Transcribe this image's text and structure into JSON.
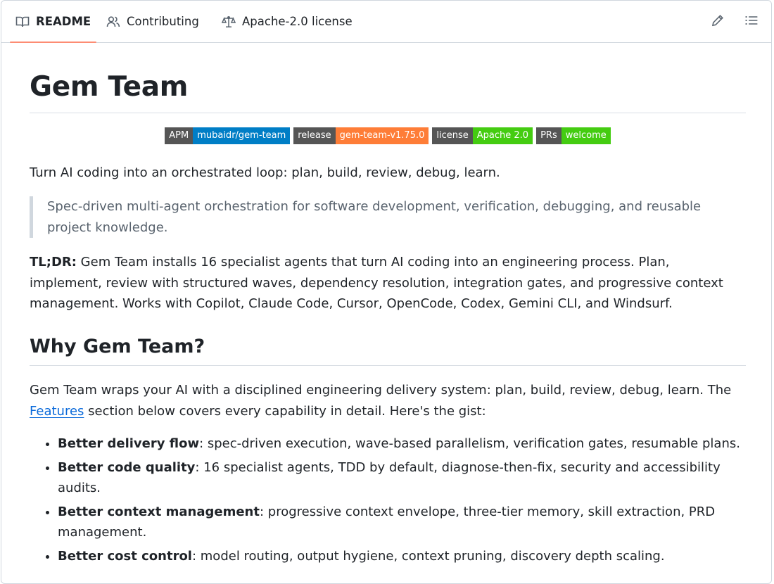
{
  "tabs": [
    {
      "label": "README",
      "icon": "book-icon",
      "active": true
    },
    {
      "label": "Contributing",
      "icon": "people-icon",
      "active": false
    },
    {
      "label": "Apache-2.0 license",
      "icon": "law-scale-icon",
      "active": false
    }
  ],
  "toolbar": {
    "edit_icon": "pencil-icon",
    "outline_icon": "list-unordered-icon"
  },
  "readme": {
    "title": "Gem Team",
    "badges": [
      {
        "label": "APM",
        "value": "mubaidr/gem-team",
        "color": "#007ec6"
      },
      {
        "label": "release",
        "value": "gem-team-v1.75.0",
        "color": "#fe7d37"
      },
      {
        "label": "license",
        "value": "Apache 2.0",
        "color": "#4c1"
      },
      {
        "label": "PRs",
        "value": "welcome",
        "color": "#4c1"
      }
    ],
    "tagline": "Turn AI coding into an orchestrated loop: plan, build, review, debug, learn.",
    "quote": "Spec-driven multi-agent orchestration for software development, verification, debugging, and reusable project knowledge.",
    "tldr_label": "TL;DR:",
    "tldr_text": " Gem Team installs 16 specialist agents that turn AI coding into an engineering process. Plan, implement, review with structured waves, dependency resolution, integration gates, and progressive context management. Works with Copilot, Claude Code, Cursor, OpenCode, Codex, Gemini CLI, and Windsurf.",
    "why_heading": "Why Gem Team?",
    "why_intro_1": "Gem Team wraps your AI with a disciplined engineering delivery system: plan, build, review, debug, learn. The ",
    "why_link": "Features",
    "why_intro_2": " section below covers every capability in detail. Here's the gist:",
    "bullets": [
      {
        "title": "Better delivery flow",
        "text": ": spec-driven execution, wave-based parallelism, verification gates, resumable plans."
      },
      {
        "title": "Better code quality",
        "text": ": 16 specialist agents, TDD by default, diagnose-then-fix, security and accessibility audits."
      },
      {
        "title": "Better context management",
        "text": ": progressive context envelope, three-tier memory, skill extraction, PRD management."
      },
      {
        "title": "Better cost control",
        "text": ": model routing, output hygiene, context pruning, discovery depth scaling."
      }
    ]
  }
}
